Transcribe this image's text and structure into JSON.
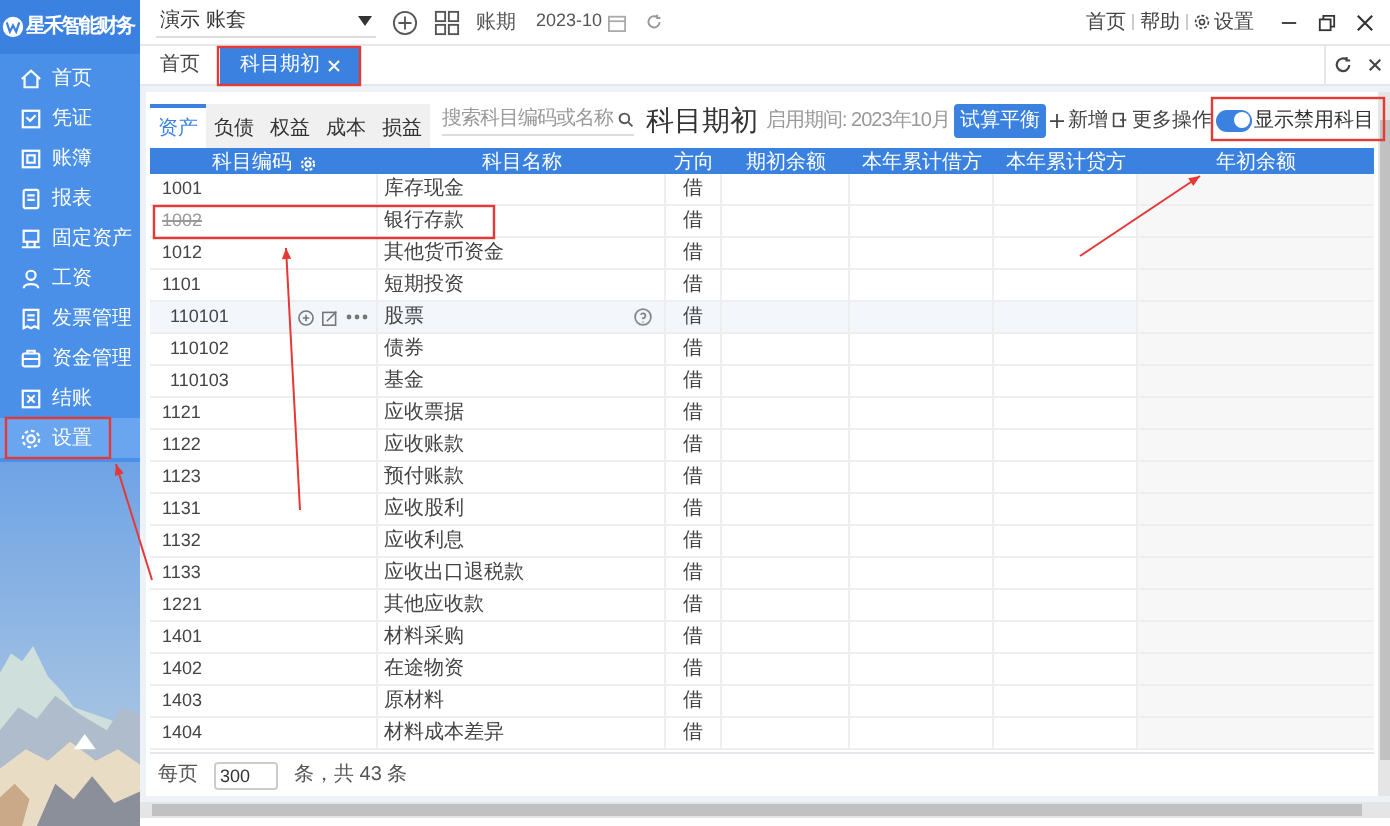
{
  "app": {
    "logo": "星禾智能财务"
  },
  "sidebar": {
    "items": [
      {
        "label": "首页",
        "selected": false
      },
      {
        "label": "凭证",
        "selected": false
      },
      {
        "label": "账簿",
        "selected": false
      },
      {
        "label": "报表",
        "selected": false
      },
      {
        "label": "固定资产",
        "selected": false
      },
      {
        "label": "工资",
        "selected": false
      },
      {
        "label": "发票管理",
        "selected": false
      },
      {
        "label": "资金管理",
        "selected": false
      },
      {
        "label": "结账",
        "selected": false
      },
      {
        "label": "设置",
        "selected": true
      }
    ]
  },
  "topbar": {
    "account": "演示 账套",
    "period_label": "账期",
    "period": "2023-10",
    "links": [
      "首页",
      "帮助",
      "设置"
    ]
  },
  "tabs": [
    {
      "label": "首页",
      "selected": false,
      "closable": false
    },
    {
      "label": "科目期初",
      "selected": true,
      "closable": true
    }
  ],
  "page": {
    "category_tabs": [
      {
        "label": "资产",
        "selected": true
      },
      {
        "label": "负债",
        "selected": false
      },
      {
        "label": "权益",
        "selected": false
      },
      {
        "label": "成本",
        "selected": false
      },
      {
        "label": "损益",
        "selected": false
      }
    ],
    "search_placeholder": "搜索科目编码或名称",
    "title": "科目期初",
    "period_label": "启用期间:",
    "period": "2023年10月",
    "actions": [
      {
        "kind": "primary",
        "label": "试算平衡"
      },
      {
        "kind": "add",
        "label": "新增"
      },
      {
        "kind": "more",
        "label": "更多操作"
      }
    ],
    "toggle": {
      "label": "显示禁用科目",
      "on": true
    }
  },
  "table": {
    "columns": [
      "科目编码",
      "科目名称",
      "方向",
      "期初余额",
      "本年累计借方",
      "本年累计贷方",
      "年初余额"
    ],
    "rows": [
      {
        "code": "1001",
        "name": "库存现金",
        "direction": "借",
        "disabled": false,
        "highlighted": false
      },
      {
        "code": "1002",
        "name": "银行存款",
        "direction": "借",
        "disabled": true,
        "highlighted": false
      },
      {
        "code": "1012",
        "name": "其他货币资金",
        "direction": "借",
        "disabled": false,
        "highlighted": false
      },
      {
        "code": "1101",
        "name": "短期投资",
        "direction": "借",
        "disabled": false,
        "highlighted": false,
        "children": [
          {
            "code": "110101",
            "name": "股票",
            "direction": "借",
            "disabled": false,
            "highlighted": true
          },
          {
            "code": "110102",
            "name": "债券",
            "direction": "借",
            "disabled": false,
            "highlighted": false
          },
          {
            "code": "110103",
            "name": "基金",
            "direction": "借",
            "disabled": false,
            "highlighted": false
          }
        ]
      },
      {
        "code": "1121",
        "name": "应收票据",
        "direction": "借",
        "disabled": false,
        "highlighted": false
      },
      {
        "code": "1122",
        "name": "应收账款",
        "direction": "借",
        "disabled": false,
        "highlighted": false
      },
      {
        "code": "1123",
        "name": "预付账款",
        "direction": "借",
        "disabled": false,
        "highlighted": false
      },
      {
        "code": "1131",
        "name": "应收股利",
        "direction": "借",
        "disabled": false,
        "highlighted": false
      },
      {
        "code": "1132",
        "name": "应收利息",
        "direction": "借",
        "disabled": false,
        "highlighted": false
      },
      {
        "code": "1133",
        "name": "应收出口退税款",
        "direction": "借",
        "disabled": false,
        "highlighted": false
      },
      {
        "code": "1221",
        "name": "其他应收款",
        "direction": "借",
        "disabled": false,
        "highlighted": false
      },
      {
        "code": "1401",
        "name": "材料采购",
        "direction": "借",
        "disabled": false,
        "highlighted": false
      },
      {
        "code": "1402",
        "name": "在途物资",
        "direction": "借",
        "disabled": false,
        "highlighted": false
      },
      {
        "code": "1403",
        "name": "原材料",
        "direction": "借",
        "disabled": false,
        "highlighted": false
      },
      {
        "code": "1404",
        "name": "材料成本差异",
        "direction": "借",
        "disabled": false,
        "highlighted": false
      }
    ]
  },
  "pagination": {
    "per_page_label": "每页",
    "per_page": "300",
    "total": "条，共 43 条"
  }
}
